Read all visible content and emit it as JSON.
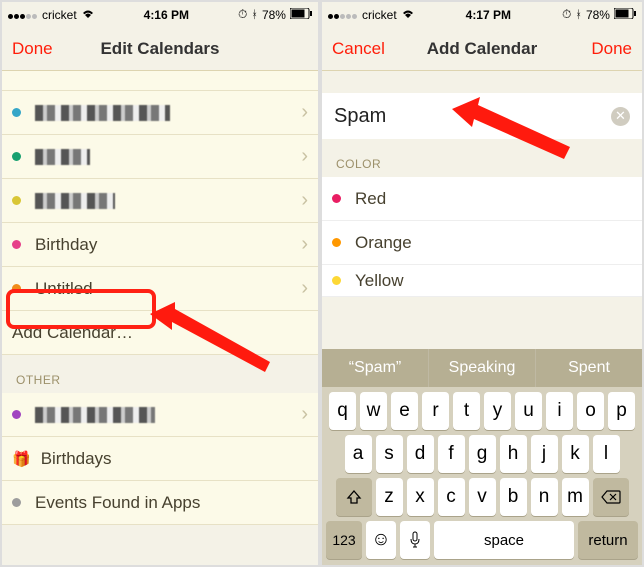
{
  "left": {
    "status": {
      "carrier": "cricket",
      "time": "4:16 PM",
      "battery": "78%"
    },
    "nav": {
      "done": "Done",
      "title": "Edit Calendars"
    },
    "rows": {
      "birthday": "Birthday",
      "untitled": "Untitled",
      "add": "Add Calendar…"
    },
    "other_header": "OTHER",
    "other_rows": {
      "birthdays": "Birthdays",
      "events": "Events Found in Apps"
    }
  },
  "right": {
    "status": {
      "carrier": "cricket",
      "time": "4:17 PM",
      "battery": "78%"
    },
    "nav": {
      "cancel": "Cancel",
      "title": "Add Calendar",
      "done": "Done"
    },
    "input": "Spam",
    "color_header": "COLOR",
    "colors": {
      "red": "Red",
      "orange": "Orange",
      "yellow": "Yellow"
    },
    "predict": {
      "a": "“Spam”",
      "b": "Speaking",
      "c": "Spent"
    },
    "keys": {
      "row1": [
        "q",
        "w",
        "e",
        "r",
        "t",
        "y",
        "u",
        "i",
        "o",
        "p"
      ],
      "row2": [
        "a",
        "s",
        "d",
        "f",
        "g",
        "h",
        "j",
        "k",
        "l"
      ],
      "row3": [
        "z",
        "x",
        "c",
        "v",
        "b",
        "n",
        "m"
      ],
      "k123": "123",
      "space": "space",
      "return": "return"
    }
  }
}
